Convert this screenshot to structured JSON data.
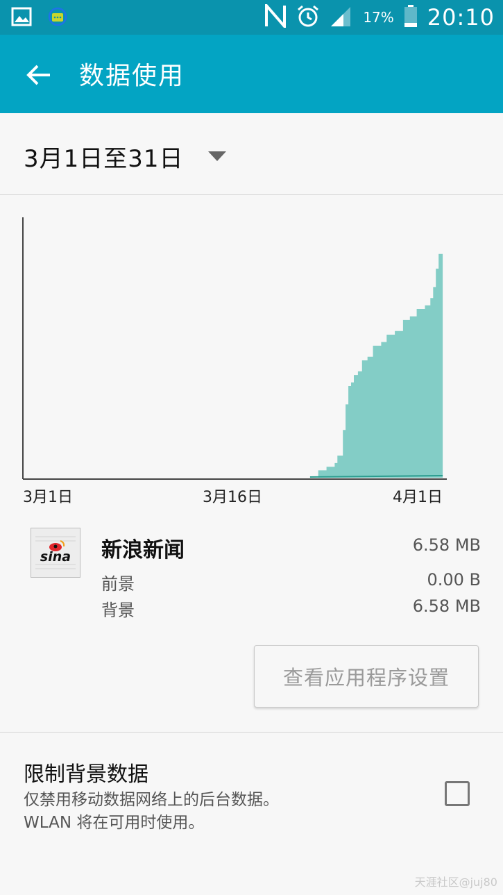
{
  "status_bar": {
    "icons_left": [
      "gallery-icon",
      "message-icon"
    ],
    "icons_right": [
      "nfc-icon",
      "alarm-icon",
      "signal-icon",
      "battery-icon"
    ],
    "battery": "17%",
    "time": "20:10"
  },
  "app_bar": {
    "title": "数据使用",
    "back_icon": "arrow-left-icon"
  },
  "period": {
    "label": "3月1日至31日",
    "dropdown_icon": "caret-down-icon"
  },
  "chart_data": {
    "type": "area",
    "x_tick_labels": [
      "3月1日",
      "3月16日",
      "4月1日"
    ],
    "unit": "MB",
    "colors": {
      "fill": "#83cdc6",
      "line": "#2a9d8f",
      "axis": "#444444"
    },
    "series": [
      {
        "values": [
          [
            22.0,
            0.0
          ],
          [
            22.6,
            0.2
          ],
          [
            23.2,
            0.3
          ],
          [
            23.8,
            0.4
          ],
          [
            24.0,
            0.6
          ],
          [
            24.4,
            1.3
          ],
          [
            24.6,
            2.0
          ],
          [
            24.8,
            2.5
          ],
          [
            25.0,
            2.6
          ],
          [
            25.2,
            2.8
          ],
          [
            25.5,
            2.9
          ],
          [
            25.8,
            3.2
          ],
          [
            26.2,
            3.3
          ],
          [
            26.6,
            3.6
          ],
          [
            27.2,
            3.7
          ],
          [
            27.6,
            3.9
          ],
          [
            28.2,
            4.0
          ],
          [
            28.8,
            4.3
          ],
          [
            29.3,
            4.4
          ],
          [
            29.8,
            4.6
          ],
          [
            30.4,
            4.7
          ],
          [
            30.8,
            4.9
          ],
          [
            31.0,
            5.2
          ],
          [
            31.2,
            5.7
          ],
          [
            31.4,
            6.1
          ],
          [
            31.55,
            6.1
          ],
          [
            31.7,
            6.58
          ]
        ]
      }
    ],
    "x_range": [
      1,
      32
    ],
    "y_range": [
      0,
      7.1
    ],
    "grid": false
  },
  "app_usage": {
    "icon": "sina-news-icon",
    "name": "新浪新闻",
    "total": "6.58 MB",
    "rows": [
      {
        "label": "前景",
        "value": "0.00 B"
      },
      {
        "label": "背景",
        "value": "6.58 MB"
      }
    ],
    "settings_button": "查看应用程序设置"
  },
  "restrict": {
    "title": "限制背景数据",
    "description_line1": "仅禁用移动数据网络上的后台数据。",
    "description_line2": "WLAN 将在可用时使用。",
    "checked": false
  },
  "watermark": "天涯社区@juj80"
}
